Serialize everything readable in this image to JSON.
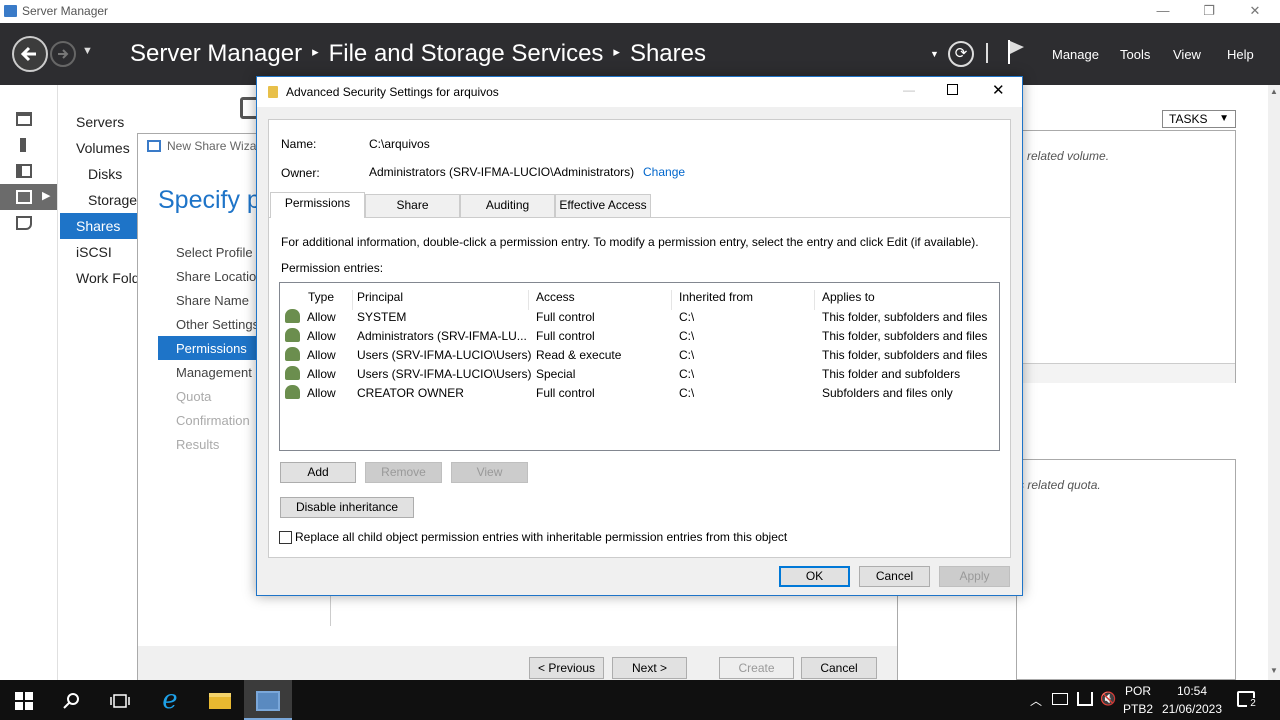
{
  "window": {
    "title": "Server Manager"
  },
  "header": {
    "crumbs": [
      "Server Manager",
      "File and Storage Services",
      "Shares"
    ],
    "menu": [
      "Manage",
      "Tools",
      "View",
      "Help"
    ]
  },
  "nav": {
    "items": [
      "Servers",
      "Volumes",
      "Disks",
      "Storage",
      "Shares",
      "iSCSI",
      "Work Fold"
    ]
  },
  "right": {
    "tasks": "TASKS",
    "volume_hint": "related volume.",
    "quota_hint": "s related quota."
  },
  "wizard": {
    "title": "New Share Wizar",
    "heading": "Specify pe",
    "steps": [
      "Select Profile",
      "Share Location",
      "Share Name",
      "Other Settings",
      "Permissions",
      "Management",
      "Quota",
      "Confirmation",
      "Results"
    ],
    "buttons": {
      "previous": "< Previous",
      "next": "Next >",
      "create": "Create",
      "cancel": "Cancel"
    }
  },
  "dialog": {
    "title": "Advanced Security Settings for arquivos",
    "name_label": "Name:",
    "name_value": "C:\\arquivos",
    "owner_label": "Owner:",
    "owner_value": "Administrators (SRV-IFMA-LUCIO\\Administrators)",
    "change": "Change",
    "tabs": [
      "Permissions",
      "Share",
      "Auditing",
      "Effective Access"
    ],
    "info": "For additional information, double-click a permission entry. To modify a permission entry, select the entry and click Edit (if available).",
    "entries_label": "Permission entries:",
    "columns": [
      "Type",
      "Principal",
      "Access",
      "Inherited from",
      "Applies to"
    ],
    "rows": [
      {
        "type": "Allow",
        "principal": "SYSTEM",
        "access": "Full control",
        "inherited": "C:\\",
        "applies": "This folder, subfolders and files"
      },
      {
        "type": "Allow",
        "principal": "Administrators (SRV-IFMA-LU...",
        "access": "Full control",
        "inherited": "C:\\",
        "applies": "This folder, subfolders and files"
      },
      {
        "type": "Allow",
        "principal": "Users (SRV-IFMA-LUCIO\\Users)",
        "access": "Read & execute",
        "inherited": "C:\\",
        "applies": "This folder, subfolders and files"
      },
      {
        "type": "Allow",
        "principal": "Users (SRV-IFMA-LUCIO\\Users)",
        "access": "Special",
        "inherited": "C:\\",
        "applies": "This folder and subfolders"
      },
      {
        "type": "Allow",
        "principal": "CREATOR OWNER",
        "access": "Full control",
        "inherited": "C:\\",
        "applies": "Subfolders and files only"
      }
    ],
    "add": "Add",
    "remove": "Remove",
    "view": "View",
    "disable_inheritance": "Disable inheritance",
    "replace_label": "Replace all child object permission entries with inheritable permission entries from this object",
    "ok": "OK",
    "cancel": "Cancel",
    "apply": "Apply"
  },
  "taskbar": {
    "lang1": "POR",
    "lang2": "PTB2",
    "time": "10:54",
    "date": "21/06/2023",
    "notif_count": "2"
  },
  "colors": {
    "accent": "#1e74c8",
    "header_bg": "#2d2d30",
    "link": "#0066cc"
  }
}
